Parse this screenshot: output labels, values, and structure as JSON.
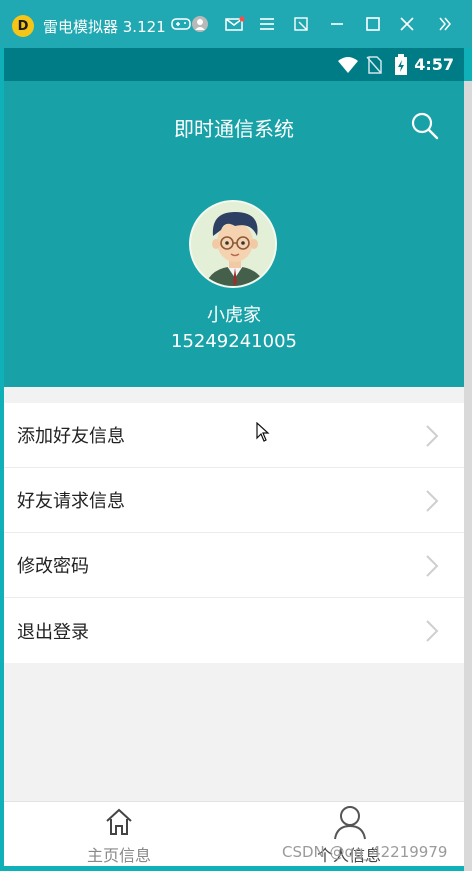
{
  "emulator": {
    "title": "雷电模拟器 3.121",
    "logo_text": "D",
    "icons": [
      "gamepad-icon",
      "user-icon",
      "mail-icon",
      "menu-icon",
      "screenshot-icon",
      "minimize-icon",
      "maximize-icon",
      "close-icon",
      "more-icon"
    ]
  },
  "status_bar": {
    "time": "4:57",
    "icons": [
      "wifi-icon",
      "no-sim-icon",
      "battery-charging-icon"
    ]
  },
  "app": {
    "title": "即时通信系统",
    "search_icon": "search-icon"
  },
  "profile": {
    "name": "小虎家",
    "phone": "15249241005"
  },
  "menu": {
    "items": [
      {
        "label": "添加好友信息"
      },
      {
        "label": "好友请求信息"
      },
      {
        "label": "修改密码"
      },
      {
        "label": "退出登录"
      }
    ]
  },
  "tabs": [
    {
      "label": "主页信息",
      "icon": "home-icon"
    },
    {
      "label": "个人信息",
      "icon": "person-icon"
    }
  ],
  "watermark": "CSDN @qq_42219979",
  "colors": {
    "accent": "#18a2a8",
    "status_bar": "#007c86",
    "emulator_bar": "#20a9b2"
  }
}
